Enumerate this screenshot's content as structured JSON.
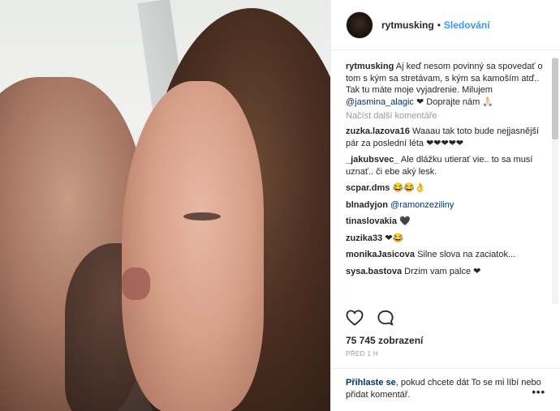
{
  "header": {
    "username": "rytmusking",
    "separator": "•",
    "follow_label": "Sledování"
  },
  "caption": {
    "username": "rytmusking",
    "text_1": "Aj keď nesom povinný sa spovedať o tom s kým sa stretávam, s kým sa kamoším atď.. Tak tu máte moje vyjadrenie. Milujem ",
    "mention": "@jasmina_alagic",
    "text_2": " ❤ Doprajte nám 🙏🏻"
  },
  "load_more_label": "Načíst další komentáře",
  "comments": [
    {
      "user": "zuzka.lazova16",
      "text": "Waaau tak toto bude nejjasnější pár za poslední léta ❤❤❤❤❤"
    },
    {
      "user": "_jakubsvec_",
      "text": "Ale dlážku utierať vie.. to sa musí uznať.. či ebe aký lesk."
    },
    {
      "user": "scpar.dms",
      "text": "😂😂👌"
    },
    {
      "user": "blnadyjon",
      "text": "",
      "mention": "@ramonzeziliny"
    },
    {
      "user": "tinaslovakia",
      "text": "🖤"
    },
    {
      "user": "zuzika33",
      "text": "❤😂"
    },
    {
      "user": "monikaJasicova",
      "text": "Silne slova na zaciatok..."
    },
    {
      "user": "sysa.bastova",
      "text": "Drzim vam palce ❤"
    }
  ],
  "icons": {
    "like": "heart-icon",
    "comment": "comment-icon",
    "more": "more-options-icon"
  },
  "likes_text": "75 745 zobrazení",
  "timestamp": "PŘED 1 H",
  "login": {
    "link": "Přihlaste se",
    "text": ", pokud chcete dát To se mi líbí nebo přidat komentář."
  },
  "more_label": "•••"
}
